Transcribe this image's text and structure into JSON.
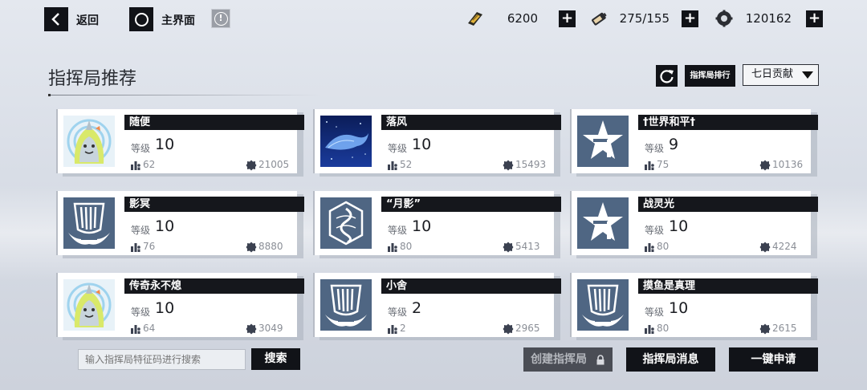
{
  "topbar": {
    "back_label": "返回",
    "home_label": "主界面",
    "info_glyph": "!",
    "resources": [
      {
        "icon": "gold-bar-icon",
        "value": "6200"
      },
      {
        "icon": "battery-icon",
        "value": "275/155"
      },
      {
        "icon": "gear-parts-icon",
        "value": "120162"
      }
    ],
    "plus_glyph": "+"
  },
  "header": {
    "title": "指挥局推荐",
    "rank_button": "指挥局排行",
    "sort_selected": "七日贡献"
  },
  "cards": [
    {
      "name": "随便",
      "level_label": "等级",
      "level": "10",
      "members": "62",
      "contribution": "21005",
      "avatar": "shark-girl"
    },
    {
      "name": "落风",
      "level_label": "等级",
      "level": "10",
      "members": "52",
      "contribution": "15493",
      "avatar": "whale-night"
    },
    {
      "name": "†世界和平†",
      "level_label": "等级",
      "level": "9",
      "members": "75",
      "contribution": "10136",
      "avatar": "star-emblem"
    },
    {
      "name": "影冥",
      "level_label": "等级",
      "level": "10",
      "members": "76",
      "contribution": "8880",
      "avatar": "wing-emblem"
    },
    {
      "name": "“月影”",
      "level_label": "等级",
      "level": "10",
      "members": "80",
      "contribution": "5413",
      "avatar": "dragon-emblem"
    },
    {
      "name": "战灵光",
      "level_label": "等级",
      "level": "10",
      "members": "80",
      "contribution": "4224",
      "avatar": "star-emblem"
    },
    {
      "name": "传奇永不熄",
      "level_label": "等级",
      "level": "10",
      "members": "64",
      "contribution": "3049",
      "avatar": "shark-girl"
    },
    {
      "name": "小舍",
      "level_label": "等级",
      "level": "2",
      "members": "2",
      "contribution": "2965",
      "avatar": "wing-emblem"
    },
    {
      "name": "摸鱼是真理",
      "level_label": "等级",
      "level": "10",
      "members": "80",
      "contribution": "2615",
      "avatar": "wing-emblem"
    }
  ],
  "bottom": {
    "search_placeholder": "输入指挥局特征码进行搜索",
    "search_button": "搜索",
    "create_button": "创建指挥局",
    "messages_button": "指挥局消息",
    "apply_button": "一键申请"
  },
  "colors": {
    "dark": "#111318",
    "emblem_blue": "#4f6683",
    "background": "#dde1e8"
  }
}
